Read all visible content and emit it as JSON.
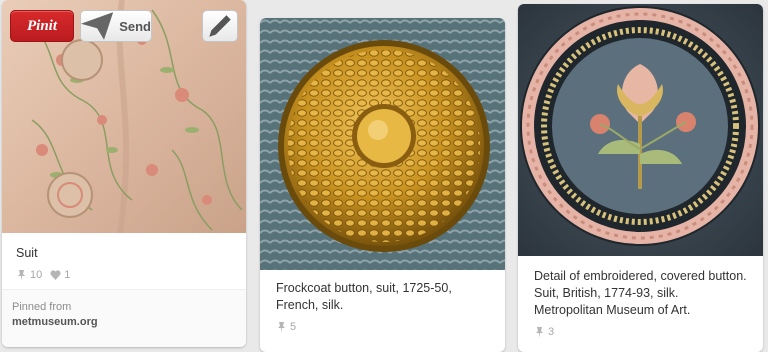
{
  "actions": {
    "pinit_label": "Pinit",
    "send_label": "Send"
  },
  "pins": [
    {
      "description": "Suit",
      "repins": "10",
      "likes": "1",
      "pinned_from_label": "Pinned from",
      "pinned_from_source": "metmuseum.org"
    },
    {
      "description": "Frockcoat button, suit, 1725-50, French, silk.",
      "repins": "5"
    },
    {
      "description": "Detail of embroidered, covered button. Suit, British, 1774-93, silk. Metropolitan Museum of Art.",
      "repins": "3"
    }
  ],
  "colors": {
    "pinit_red": "#c8232c",
    "background": "#e9e9e9",
    "card": "#ffffff"
  },
  "icons": [
    "pin-icon",
    "heart-icon",
    "send-icon",
    "pencil-icon"
  ]
}
